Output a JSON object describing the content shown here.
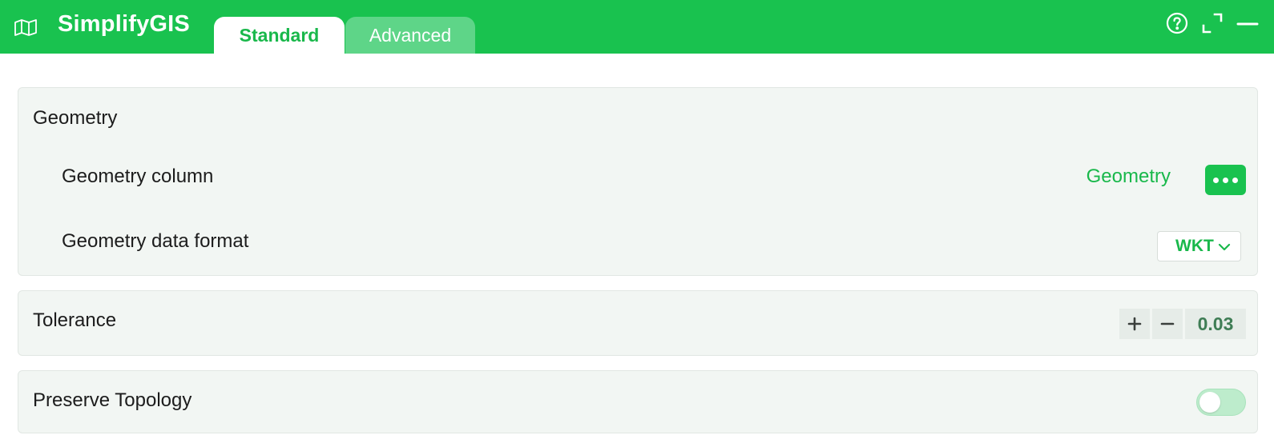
{
  "app": {
    "title": "SimplifyGIS",
    "logo_icon": "map-icon"
  },
  "tabs": [
    {
      "label": "Standard",
      "active": true
    },
    {
      "label": "Advanced",
      "active": false
    }
  ],
  "window_controls": {
    "help_icon": "help-icon",
    "maximize_icon": "maximize-icon",
    "minimize_icon": "minimize-icon"
  },
  "geometry": {
    "title": "Geometry",
    "column_label": "Geometry column",
    "column_value": "Geometry",
    "more_icon": "more-options-icon",
    "format_label": "Geometry data format",
    "format_value": "WKT",
    "format_icon": "chevron-down-icon"
  },
  "tolerance": {
    "title": "Tolerance",
    "increment_icon": "plus-icon",
    "decrement_icon": "minus-icon",
    "value": "0.03"
  },
  "topology": {
    "title": "Preserve Topology",
    "enabled": false
  },
  "colors": {
    "accent": "#19c24f",
    "accent_text": "#19b84b",
    "card_background": "#f2f6f3",
    "inactive_tab": "#5ed588",
    "toggle_track_off": "#bdeccc",
    "stepper_value": "#3f7d55"
  }
}
